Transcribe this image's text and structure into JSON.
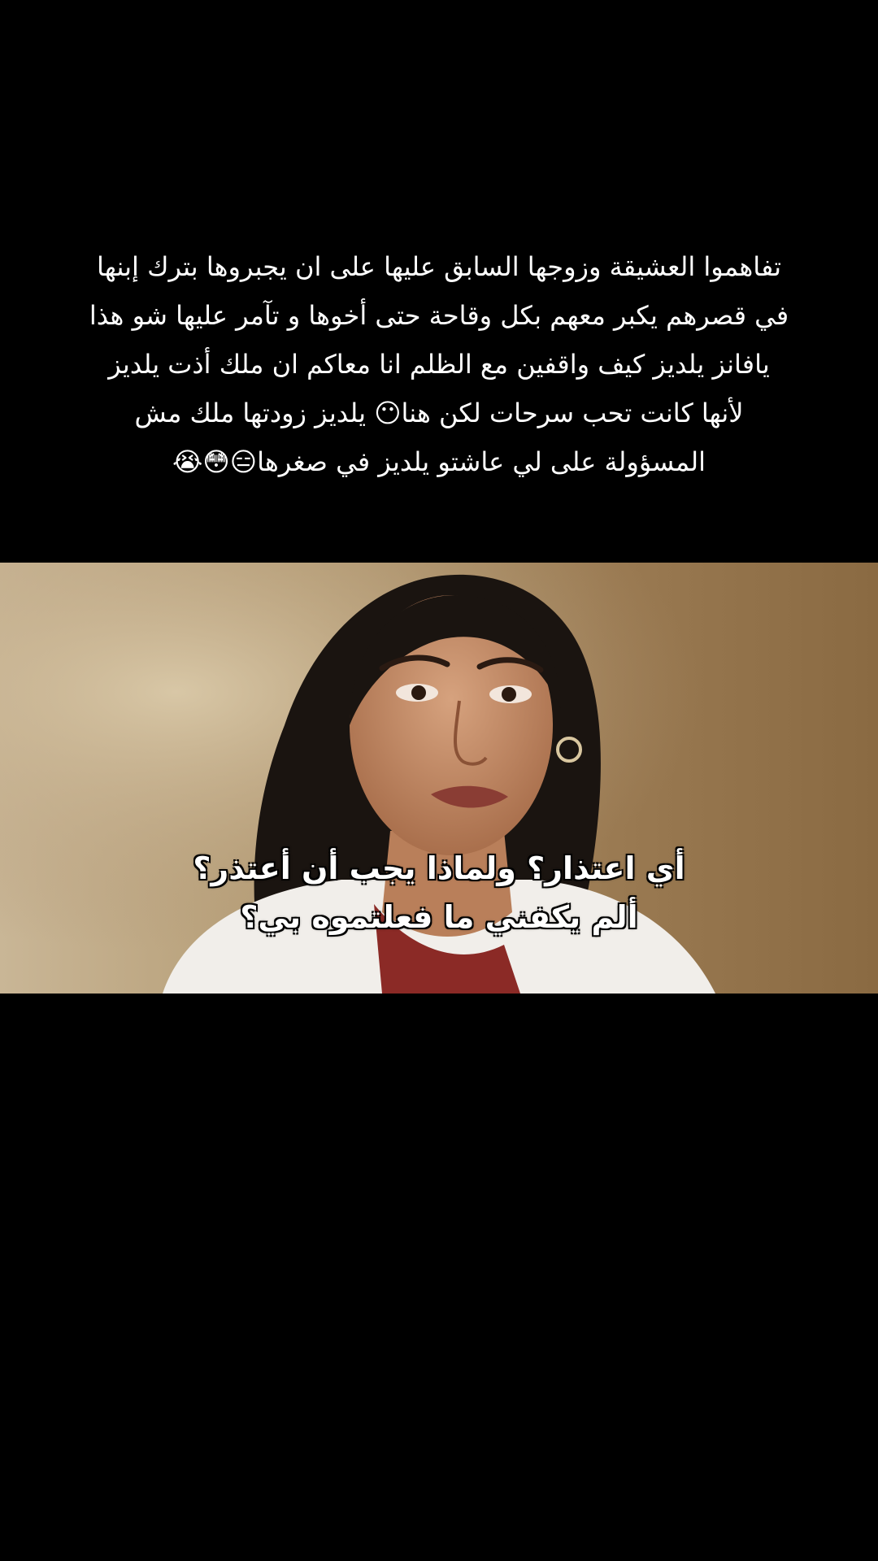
{
  "post": {
    "caption_lines": [
      "تفاهموا العشيقة وزوجها السابق عليها على ان يجبروها بترك إبنها",
      "في قصرهم يكبر معهم بكل وقاحة حتى أخوها و تآمر عليها شو هذا",
      "يافانز يلديز كيف واقفين مع الظلم انا معاكم ان ملك أذت يلديز",
      "لأنها كانت تحب سرحات لكن هنا😶 يلديز زودتها ملك مش",
      "المسؤولة على لي عاشتو يلديز في صغرها😑😳😭"
    ]
  },
  "video": {
    "subtitle_lines": [
      "أي اعتذار؟ ولماذا يجب أن أعتذر؟",
      "ألم يكفني ما فعلتموه بي؟"
    ]
  },
  "colors": {
    "background": "#000000",
    "text": "#ffffff"
  }
}
